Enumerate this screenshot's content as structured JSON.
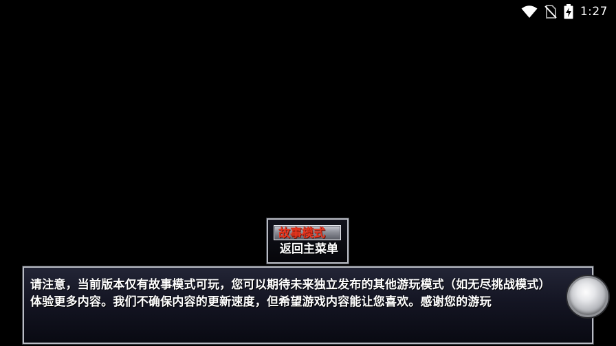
{
  "status_bar": {
    "time": "1:27",
    "icons": [
      "wifi-icon",
      "no-sim-icon",
      "battery-charging-icon"
    ]
  },
  "menu": {
    "items": [
      {
        "label": "故事模式",
        "selected": true
      },
      {
        "label": "返回主菜单",
        "selected": false
      }
    ]
  },
  "message": {
    "lines": [
      "请注意，当前版本仅有故事模式可玩，您可以期待未来独立发布的其他游玩模式（如无尽挑战模式）",
      "体验更多内容。我们不确保内容的更新速度，但希望游戏内容能让您喜欢。感谢您的游玩"
    ]
  },
  "colors": {
    "background": "#000000",
    "selected_text": "#e8351e",
    "window_border": "#b9bcc4",
    "text": "#ffffff"
  }
}
